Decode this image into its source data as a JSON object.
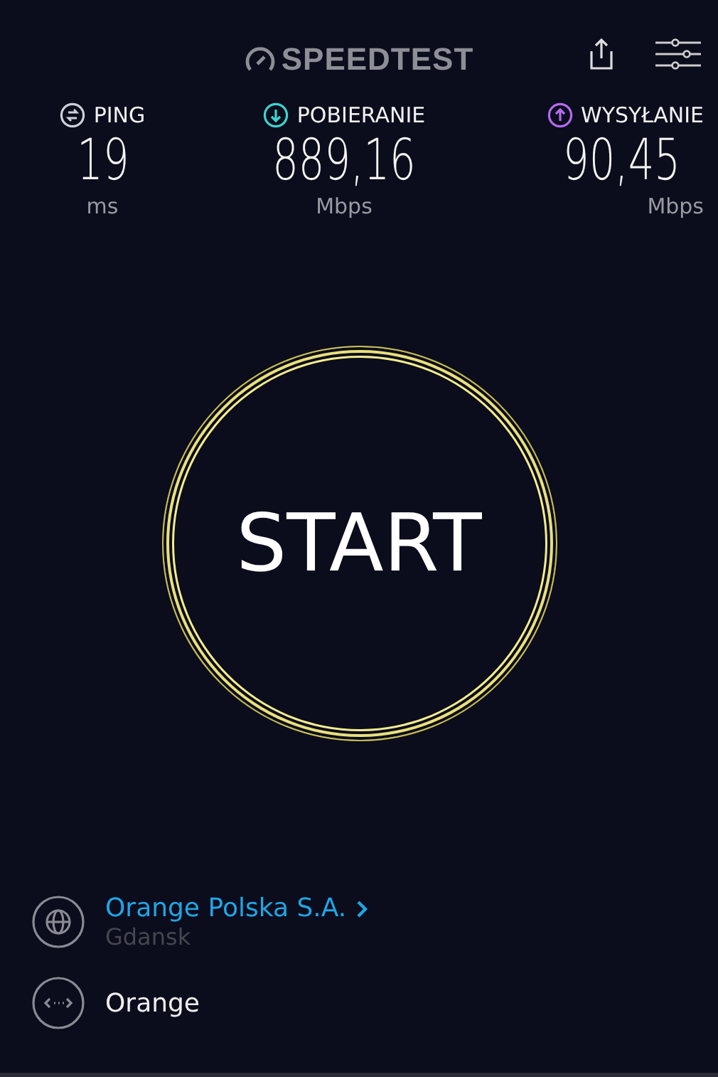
{
  "header": {
    "logo": "SPEEDTEST"
  },
  "metrics": [
    {
      "kind": "ping",
      "label": "PING",
      "value": "19",
      "unit": "ms",
      "color": "#d0d0d8"
    },
    {
      "kind": "download",
      "label": "POBIERANIE",
      "value": "889,16",
      "unit": "Mbps",
      "color": "#3dd5cf"
    },
    {
      "kind": "upload",
      "label": "WYSYŁANIE",
      "value": "90,45",
      "unit": "Mbps",
      "color": "#b46bf0"
    }
  ],
  "start_button": {
    "label": "START"
  },
  "server": {
    "name": "Orange Polska S.A.",
    "location": "Gdansk"
  },
  "connection": {
    "name": "Orange"
  }
}
